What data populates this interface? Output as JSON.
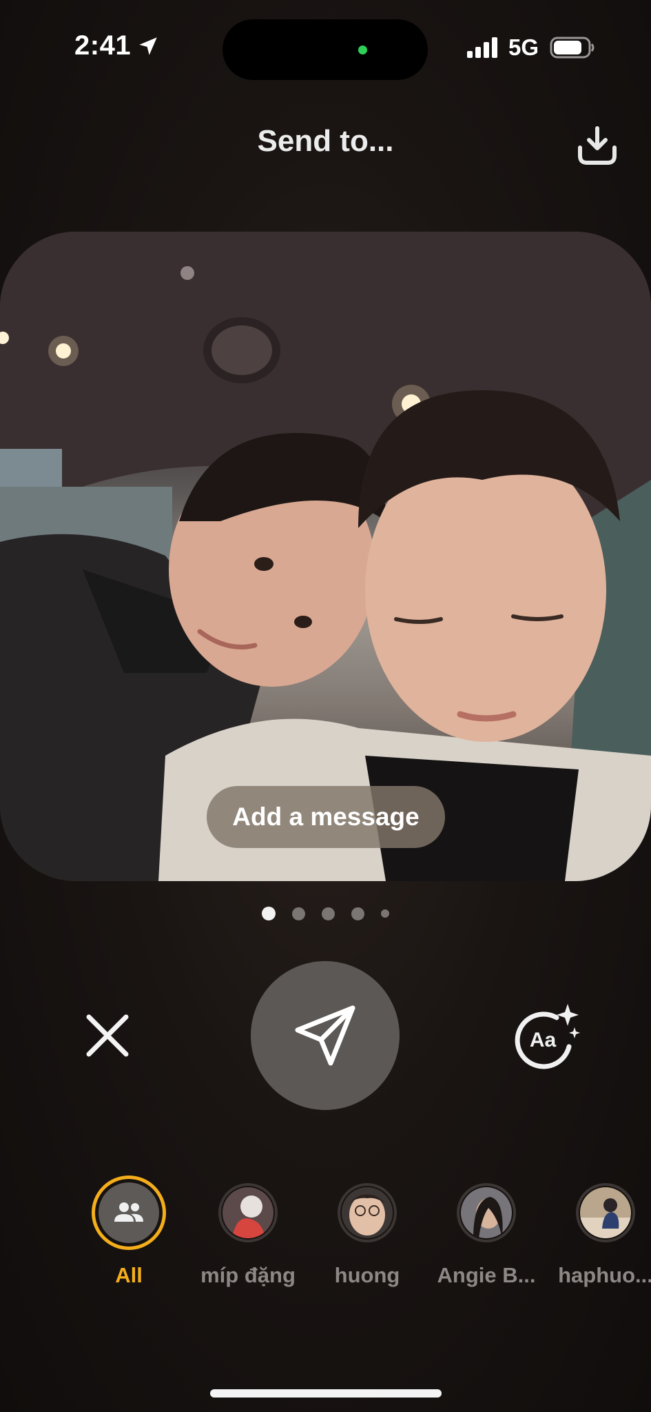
{
  "status_bar": {
    "time": "2:41",
    "network": "5G",
    "icons": [
      "location-arrow-icon",
      "signal-bars-icon",
      "battery-icon"
    ]
  },
  "header": {
    "title": "Send to...",
    "download_icon": "download-icon"
  },
  "photo": {
    "add_message_label": "Add a message"
  },
  "pagination": {
    "count": 5,
    "active_index": 0
  },
  "controls": {
    "close_icon": "close-icon",
    "send_icon": "paper-plane-icon",
    "text_style_icon": "text-style-sparkle-icon",
    "text_style_glyph": "Aa"
  },
  "recipients": [
    {
      "name": "All",
      "selected": true,
      "icon": "group-icon"
    },
    {
      "name": "míp đặng",
      "selected": false
    },
    {
      "name": "huong",
      "selected": false
    },
    {
      "name": "Angie B...",
      "selected": false
    },
    {
      "name": "haphuo...",
      "selected": false
    }
  ],
  "colors": {
    "accent": "#f4ae1c",
    "background": "#151110",
    "send_button": "#5b5856",
    "inactive_text": "#8d8886"
  }
}
